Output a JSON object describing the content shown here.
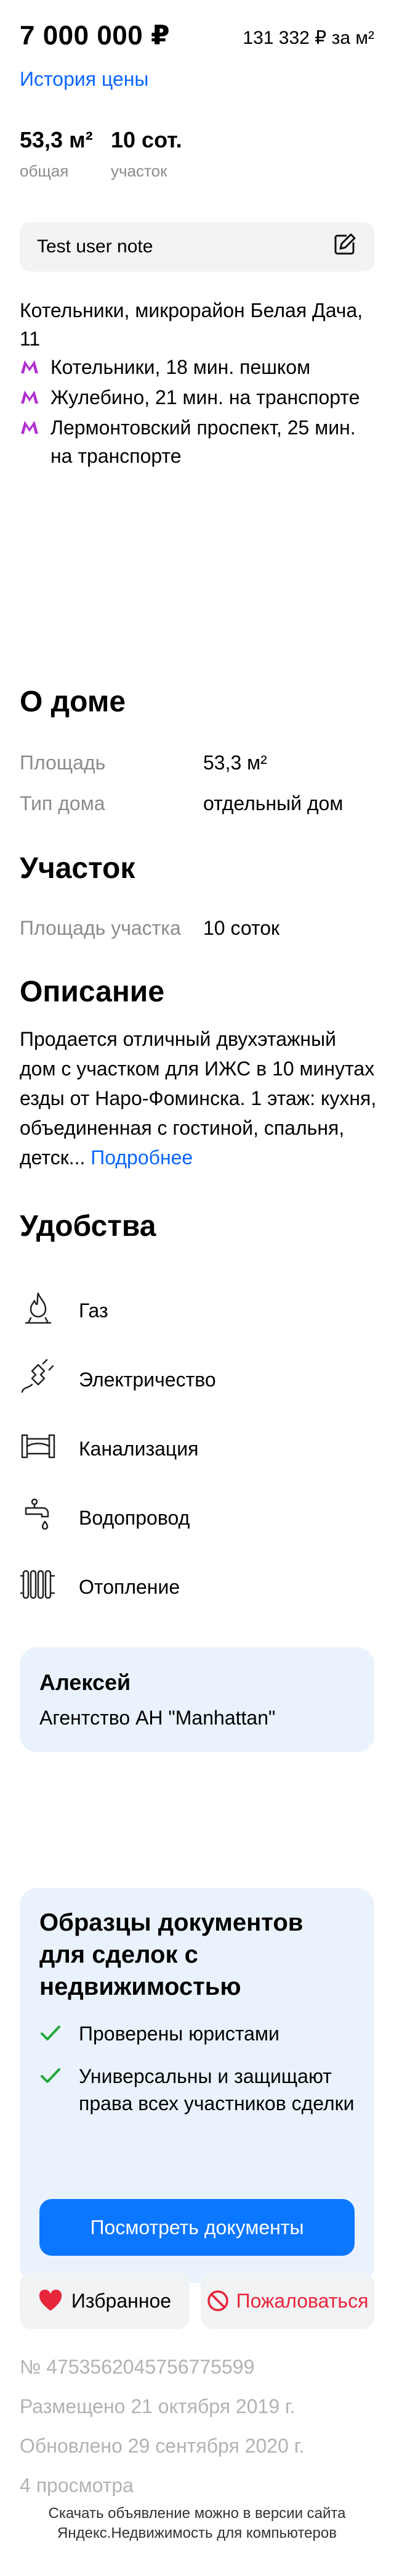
{
  "price": {
    "total": "7 000 000 ₽",
    "per_meter": "131 332 ₽ за м²",
    "history_link": "История цены"
  },
  "summary": [
    {
      "value": "53,3 м²",
      "label": "общая"
    },
    {
      "value": "10 сот.",
      "label": "участок"
    }
  ],
  "note": {
    "text": "Test user note",
    "icon": "edit-icon"
  },
  "address": {
    "text": "Котельники, микрорайон Белая Дача, 11",
    "metro": [
      {
        "icon": "metro-icon",
        "text": "Котельники, 18 мин. пешком"
      },
      {
        "icon": "metro-icon",
        "text": "Жулебино, 21 мин. на транспорте"
      },
      {
        "icon": "metro-icon",
        "text": "Лермонтовский проспект, 25 мин. на транспорте"
      }
    ],
    "metro_color": "#b02fd1"
  },
  "house": {
    "title": "О доме",
    "rows": [
      {
        "label": "Площадь",
        "value": "53,3 м²"
      },
      {
        "label": "Тип дома",
        "value": "отдельный дом"
      }
    ]
  },
  "plot": {
    "title": "Участок",
    "rows": [
      {
        "label": "Площадь участка",
        "value": "10 соток"
      }
    ]
  },
  "description": {
    "title": "Описание",
    "text": "Продается отличный двухэтажный дом с участком для ИЖС в 10 минутах езды от Наро-Фоминска. 1 этаж: кухня, объединенная с гостиной, спальня, детск...",
    "more": "Подробнее"
  },
  "facilities": {
    "title": "Удобства",
    "items": [
      {
        "icon": "gas-icon",
        "label": "Газ"
      },
      {
        "icon": "electricity-icon",
        "label": "Электричество"
      },
      {
        "icon": "sewerage-icon",
        "label": "Канализация"
      },
      {
        "icon": "water-supply-icon",
        "label": "Водопровод"
      },
      {
        "icon": "heating-icon",
        "label": "Отопление"
      }
    ]
  },
  "agent": {
    "name": "Алексей",
    "agency": "Агентство АН \"Manhattan\""
  },
  "documents": {
    "title": "Образцы документов для сделок с недвижимостью",
    "checks": [
      "Проверены юристами",
      "Универсальны и защищают права всех участников сделки"
    ],
    "button": "Посмотреть документы",
    "button_color": "#0b77ff",
    "check_color": "#22a83a"
  },
  "actions": {
    "favorite": {
      "icon": "heart-icon",
      "label": "Избранное",
      "color": "#e8263a"
    },
    "complain": {
      "icon": "prohibited-icon",
      "label": "Пожаловаться",
      "color": "#e8263a"
    }
  },
  "meta": {
    "id": "№ 4753562045756775599",
    "posted": "Размещено 21 октября 2019 г.",
    "updated": "Обновлено 29 сентября 2020 г.",
    "views": "4 просмотра"
  },
  "footer": {
    "line1": "Скачать объявление можно в версии сайта",
    "line2": "Яндекс.Недвижимость для компьютеров"
  }
}
